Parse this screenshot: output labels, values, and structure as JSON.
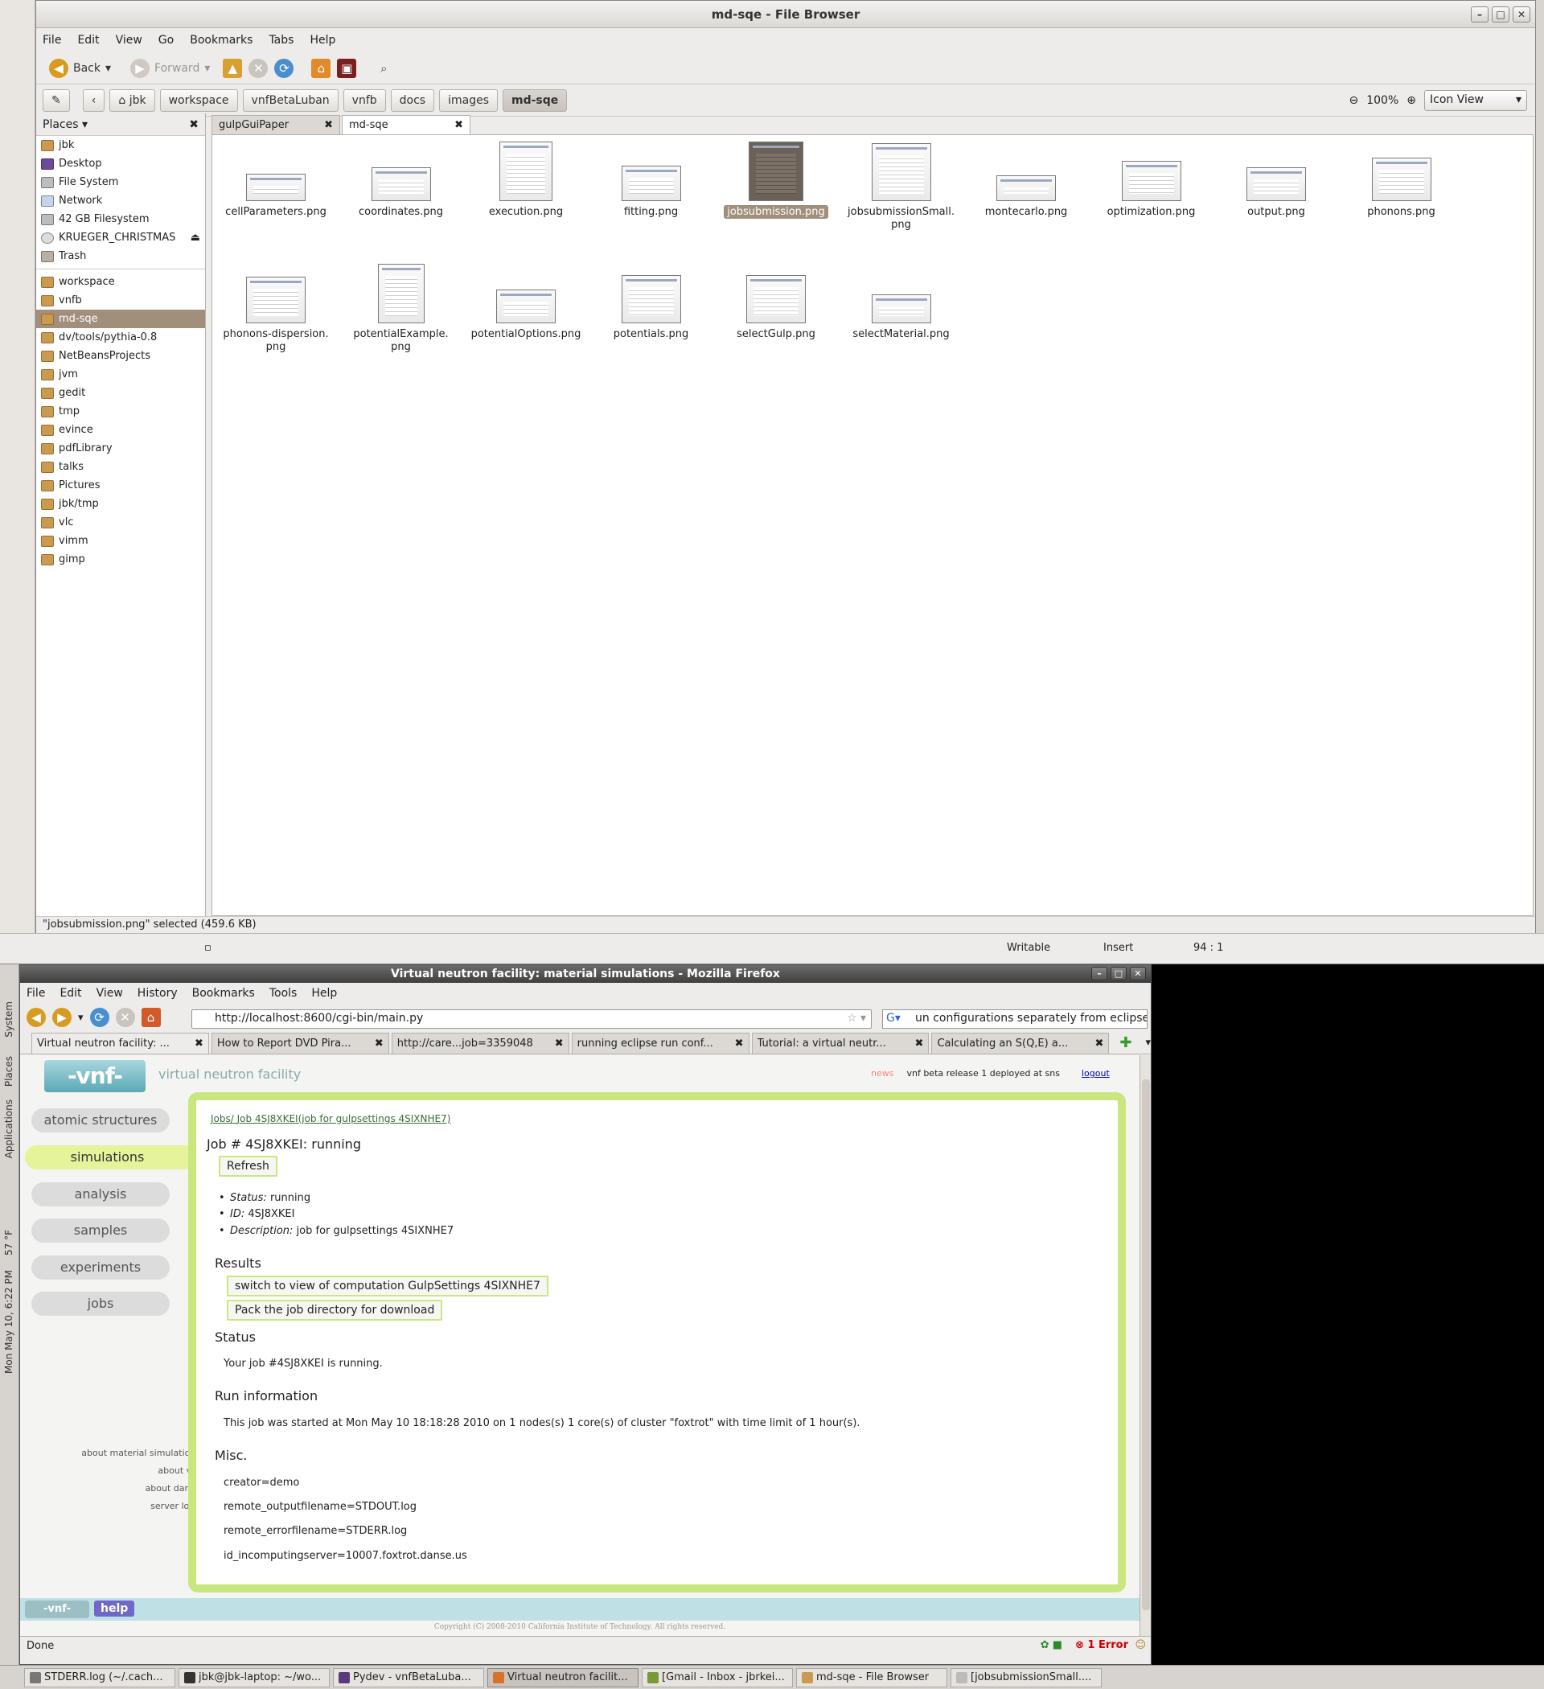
{
  "filebrowser": {
    "title": "md-sqe - File Browser",
    "menu": [
      "File",
      "Edit",
      "View",
      "Go",
      "Bookmarks",
      "Tabs",
      "Help"
    ],
    "toolbar": {
      "back": "Back",
      "forward": "Forward"
    },
    "breadcrumbs": [
      "jbk",
      "workspace",
      "vnfBetaLuban",
      "vnfb",
      "docs",
      "images",
      "md-sqe"
    ],
    "zoom": "100%",
    "view_mode": "Icon View",
    "places_label": "Places",
    "places": [
      "jbk",
      "Desktop",
      "File System",
      "Network",
      "42 GB Filesystem",
      "KRUEGER_CHRISTMAS",
      "Trash"
    ],
    "bookmarks": [
      "workspace",
      "vnfb",
      "md-sqe",
      "dv/tools/pythia-0.8",
      "NetBeansProjects",
      "jvm",
      "gedit",
      "tmp",
      "evince",
      "pdfLibrary",
      "talks",
      "Pictures",
      "jbk/tmp",
      "vlc",
      "vimm",
      "gimp"
    ],
    "tabs": [
      {
        "label": "gulpGuiPaper"
      },
      {
        "label": "md-sqe"
      }
    ],
    "files_row1": [
      "cellParameters.png",
      "coordinates.png",
      "execution.png",
      "fitting.png",
      "jobsubmission.png",
      "jobsubmissionSmall.\npng",
      "montecarlo.png",
      "optimization.png",
      "output.png",
      "phonons.png"
    ],
    "files_row2": [
      "phonons-dispersion.\npng",
      "potentialExample.\npng",
      "potentialOptions.png",
      "potentials.png",
      "selectGulp.png",
      "selectMaterial.png"
    ],
    "status": "\"jobsubmission.png\" selected (459.6 KB)"
  },
  "gedit_status": {
    "writable": "Writable",
    "mode": "Insert",
    "position": "94 : 1"
  },
  "firefox": {
    "title": "Virtual neutron facility: material simulations - Mozilla Firefox",
    "menu": [
      "File",
      "Edit",
      "View",
      "History",
      "Bookmarks",
      "Tools",
      "Help"
    ],
    "url": "http://localhost:8600/cgi-bin/main.py",
    "search": "un configurations separately from eclipse",
    "tabs": [
      "Virtual neutron facility: ...",
      "How to Report DVD Pira...",
      "http://care...job=3359048",
      "running eclipse run conf...",
      "Tutorial: a virtual neutr...",
      "Calculating an S(Q,E) a..."
    ],
    "status": "Done",
    "errors": "1 Error"
  },
  "vnf": {
    "logo": "-vnf-",
    "site_name": "virtual neutron facility",
    "news_label": "news",
    "news_text": "vnf beta release 1 deployed at sns",
    "logout": "logout",
    "nav": [
      "atomic structures",
      "simulations",
      "analysis",
      "samples",
      "experiments",
      "jobs"
    ],
    "footer_links": [
      "about material simulations",
      "about vnf",
      "about danse",
      "server load"
    ],
    "breadcrumb_root": "Jobs/",
    "breadcrumb_job": "Job 4SJ8XKEI(job for gulpsettings 4SIXNHE7)",
    "job_heading": "Job # 4SJ8XKEI: running",
    "refresh": "Refresh",
    "details": [
      {
        "label": "Status:",
        "value": "running"
      },
      {
        "label": "ID:",
        "value": "4SJ8XKEI"
      },
      {
        "label": "Description:",
        "value": "job for gulpsettings 4SIXNHE7"
      }
    ],
    "results_heading": "Results",
    "switch_button": "switch to view of computation GulpSettings 4SIXNHE7",
    "pack_button": "Pack the job directory for download",
    "status_heading": "Status",
    "status_text": "Your job #4SJ8XKEI is running.",
    "runinfo_heading": "Run information",
    "runinfo_text": "This job was started at Mon May 10 18:18:28 2010 on 1 nodes(s) 1 core(s) of cluster \"foxtrot\" with time limit of 1 hour(s).",
    "misc_heading": "Misc.",
    "misc": [
      "creator=demo",
      "remote_outputfilename=STDOUT.log",
      "remote_errorfilename=STDERR.log",
      "id_incomputingserver=10007.foxtrot.danse.us"
    ],
    "help": "help",
    "copyright": "Copyright (C) 2008-2010 California Institute of Technology. All rights reserved."
  },
  "panel_left": [
    "System",
    "Places",
    "Applications",
    "57 °F",
    "Mon May 10,  6:22 PM"
  ],
  "taskbar": [
    "STDERR.log (~/.cach...",
    "jbk@jbk-laptop: ~/wo...",
    "Pydev - vnfBetaLuba...",
    "Virtual neutron facilit...",
    "[Gmail - Inbox - jbrkei...",
    "md-sqe - File Browser",
    "[jobsubmissionSmall...."
  ]
}
